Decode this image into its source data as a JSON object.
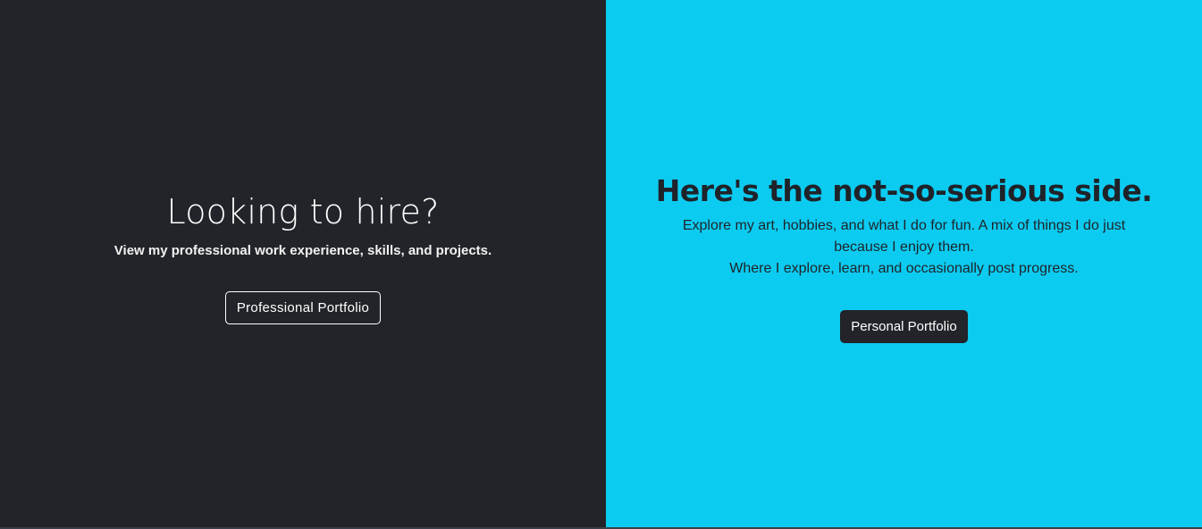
{
  "professional": {
    "title": "Looking to hire?",
    "subtitle": "View my professional work experience, skills, and projects.",
    "button_label": "Professional Portfolio",
    "background": "#222429"
  },
  "personal": {
    "title": "Here's the not-so-serious side.",
    "description_line1": "Explore my art, hobbies, and what I do for fun. A mix of things I do just because I enjoy them.",
    "description_line2": "Where I explore, learn, and occasionally post progress.",
    "button_label": "Personal Portfolio",
    "background": "#0ccbf0"
  }
}
